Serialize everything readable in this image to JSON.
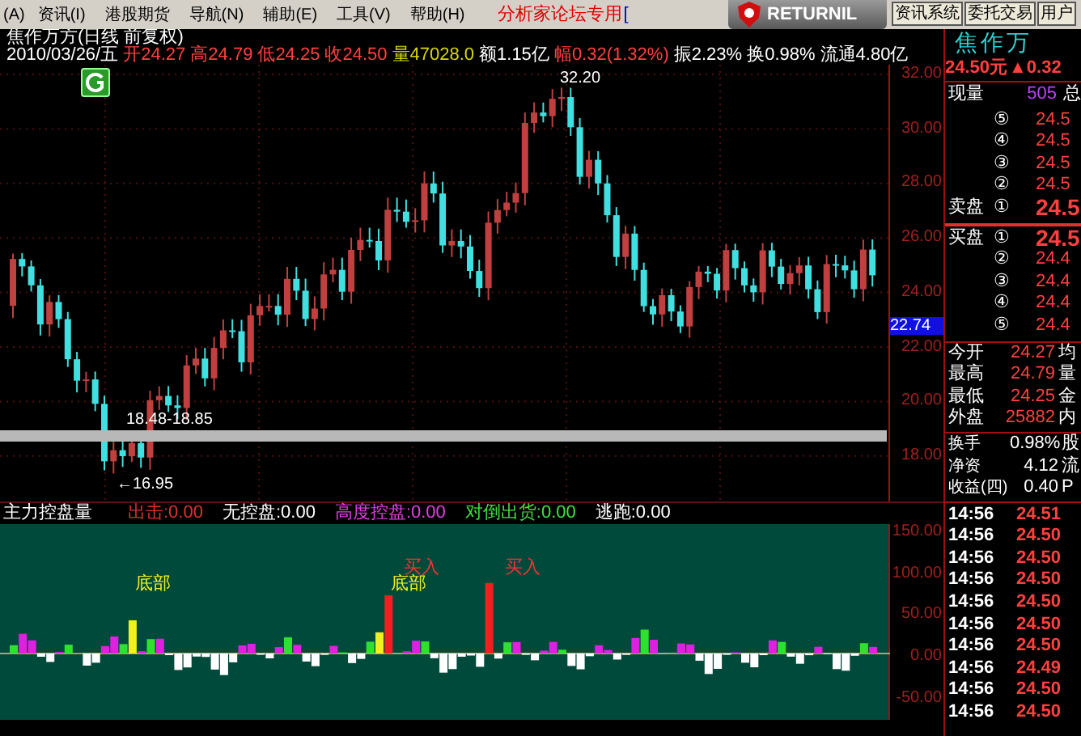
{
  "menu": {
    "items": [
      "(A)",
      "资讯(I)",
      "港股期货",
      "导航(N)",
      "辅助(E)",
      "工具(V)",
      "帮助(H)"
    ],
    "notice": "分析家论坛专用",
    "notice_tail": "[",
    "badge": "RETURNIL",
    "buttons": [
      "资讯系统",
      "委托交易",
      "用户"
    ]
  },
  "chart": {
    "title": "焦作万方(日线 前复权)",
    "quote": [
      {
        "text": "2010/03/26/五",
        "color": "#ffffff"
      },
      {
        "text": "开24.27",
        "color": "#ff4040"
      },
      {
        "text": "高24.79",
        "color": "#ff4040"
      },
      {
        "text": "低24.25",
        "color": "#ff4040"
      },
      {
        "text": "收24.50",
        "color": "#ff4040"
      },
      {
        "text": "量47028.0",
        "color": "#d8d800"
      },
      {
        "text": "额1.15亿",
        "color": "#ffffff"
      },
      {
        "text": "幅0.32(1.32%)",
        "color": "#ff4040"
      },
      {
        "text": "振2.23%",
        "color": "#ffffff"
      },
      {
        "text": "换0.98%",
        "color": "#ffffff"
      },
      {
        "text": "流通4.80亿",
        "color": "#ffffff"
      }
    ],
    "y_labels": [
      "32.00",
      "30.00",
      "28.00",
      "26.00",
      "24.00",
      "22.00",
      "20.00",
      "18.00"
    ],
    "price_tag": "22.74",
    "high_label": "32.20",
    "low_label": "←16.95",
    "range_label": "18.48-18.85"
  },
  "indicator": {
    "name": "主力控盘量",
    "values": [
      {
        "text": "出击:0.00",
        "color": "#e03030"
      },
      {
        "text": "无控盘:0.00",
        "color": "#ffffff"
      },
      {
        "text": "高度控盘:0.00",
        "color": "#e040e0"
      },
      {
        "text": "对倒出货:0.00",
        "color": "#40e040"
      },
      {
        "text": "逃跑:0.00",
        "color": "#ffffff"
      }
    ],
    "y_labels": [
      "150.00",
      "100.00",
      "50.00",
      "0.00",
      "-50.00"
    ],
    "markers": [
      {
        "kind": "bottom",
        "text": "底部"
      },
      {
        "kind": "bottom",
        "text": "底部"
      },
      {
        "kind": "buy",
        "text": "买入"
      },
      {
        "kind": "buy",
        "text": "买入"
      }
    ]
  },
  "quote_panel": {
    "name": "焦作万",
    "price": "24.50元",
    "change": "▲0.32",
    "volume_label": "现量",
    "volume": "505",
    "volume_tail": "总",
    "asks": [
      {
        "num": "⑤",
        "price": "24.5"
      },
      {
        "num": "④",
        "price": "24.5"
      },
      {
        "num": "③",
        "price": "24.5"
      },
      {
        "num": "②",
        "price": "24.5"
      },
      {
        "label": "卖盘",
        "num": "①",
        "price": "24.5"
      }
    ],
    "bids": [
      {
        "label": "买盘",
        "num": "①",
        "price": "24.5"
      },
      {
        "num": "②",
        "price": "24.4"
      },
      {
        "num": "③",
        "price": "24.4"
      },
      {
        "num": "④",
        "price": "24.4"
      },
      {
        "num": "⑤",
        "price": "24.4"
      }
    ],
    "stats": [
      {
        "label": "今开",
        "value": "24.27",
        "tail": "均"
      },
      {
        "label": "最高",
        "value": "24.79",
        "tail": "量"
      },
      {
        "label": "最低",
        "value": "24.25",
        "tail": "金"
      },
      {
        "label": "外盘",
        "value": "25882",
        "tail": "内"
      }
    ],
    "stats2": [
      {
        "label": "换手",
        "value": "0.98%",
        "tail": "股"
      },
      {
        "label": "净资",
        "value": "4.12",
        "tail": "流"
      },
      {
        "label": "收益(四)",
        "value": "0.40",
        "tail": "P"
      }
    ],
    "ticks": [
      {
        "time": "14:56",
        "price": "24.51"
      },
      {
        "time": "14:56",
        "price": "24.50"
      },
      {
        "time": "14:56",
        "price": "24.50"
      },
      {
        "time": "14:56",
        "price": "24.50"
      },
      {
        "time": "14:56",
        "price": "24.50"
      },
      {
        "time": "14:56",
        "price": "24.50"
      },
      {
        "time": "14:56",
        "price": "24.50"
      },
      {
        "time": "14:56",
        "price": "24.49"
      },
      {
        "time": "14:56",
        "price": "24.50"
      },
      {
        "time": "14:56",
        "price": "24.50"
      }
    ]
  }
}
